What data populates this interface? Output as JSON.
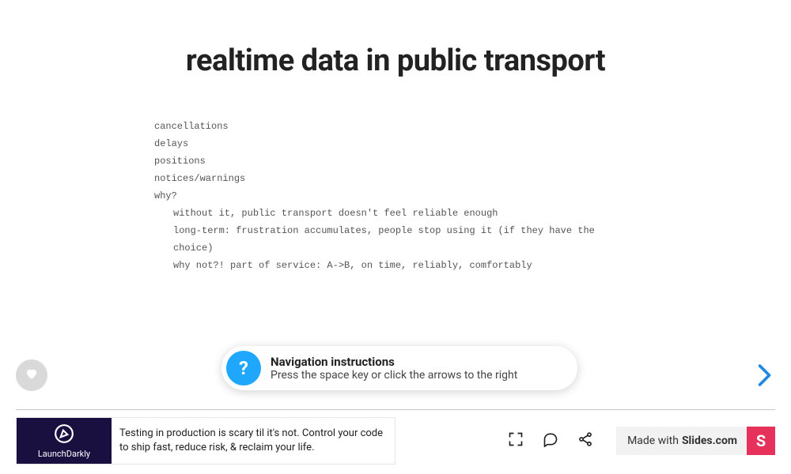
{
  "slide": {
    "title": "realtime data in public transport",
    "lines": [
      "cancellations",
      "delays",
      "positions",
      "notices/warnings",
      "why?"
    ],
    "sublines": [
      "without it, public transport doesn't feel reliable enough",
      "long-term: frustration accumulates, people stop using it (if they have the choice)",
      "why not?! part of service: A->B, on time, reliably, comfortably"
    ]
  },
  "tip": {
    "title": "Navigation instructions",
    "sub": "Press the space key or click the arrows to the right",
    "icon": "?"
  },
  "ad": {
    "brand": "LaunchDarkly",
    "copy": "Testing in production is scary til it's not. Control your code to ship fast, reduce risk, & reclaim your life."
  },
  "footer": {
    "made_prefix": "Made with ",
    "made_brand": "Slides.com",
    "badge": "S"
  }
}
